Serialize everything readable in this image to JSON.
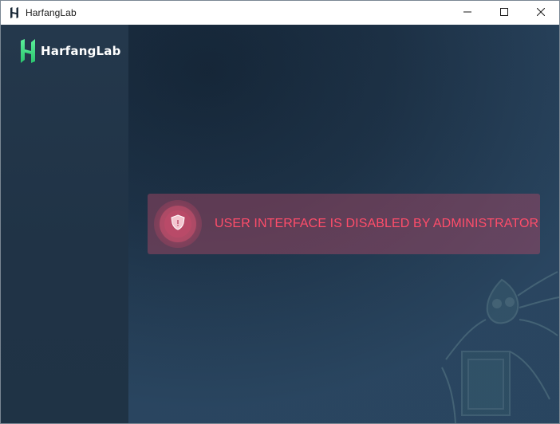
{
  "window": {
    "title": "HarfangLab",
    "controls": {
      "minimize_icon": "minimize-icon",
      "maximize_icon": "maximize-icon",
      "close_icon": "close-icon"
    }
  },
  "sidebar": {
    "brand_name": "HarfangLab",
    "brand_logo_icon": "harfanglab-logo-icon"
  },
  "main": {
    "alert": {
      "message": "USER INTERFACE IS DISABLED BY ADMINISTRATOR",
      "icon": "shield-alert-icon",
      "color": "#ff4d6a"
    }
  },
  "colors": {
    "background_dark": "#142435",
    "sidebar": "#24384c",
    "alert_background": "#b04a66",
    "brand_logo_green": "#3ddc84"
  }
}
